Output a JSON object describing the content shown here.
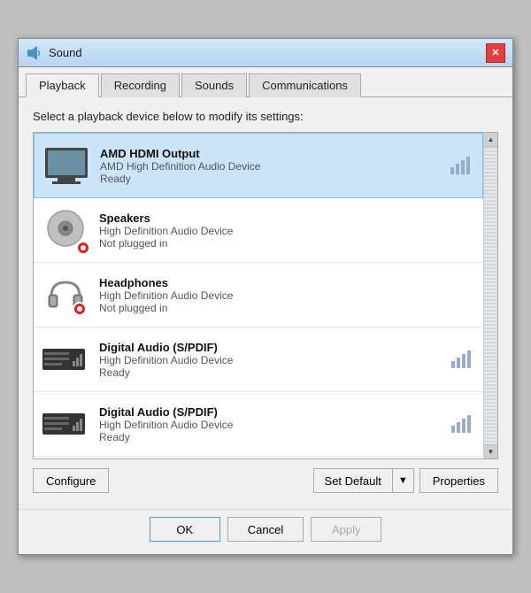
{
  "window": {
    "title": "Sound",
    "close_label": "✕"
  },
  "tabs": [
    {
      "id": "playback",
      "label": "Playback",
      "active": true
    },
    {
      "id": "recording",
      "label": "Recording",
      "active": false
    },
    {
      "id": "sounds",
      "label": "Sounds",
      "active": false
    },
    {
      "id": "communications",
      "label": "Communications",
      "active": false
    }
  ],
  "content": {
    "instruction": "Select a playback device below to modify its settings:",
    "devices": [
      {
        "id": "amd-hdmi",
        "name": "AMD HDMI Output",
        "driver": "AMD High Definition Audio Device",
        "status": "Ready",
        "selected": true,
        "icon_type": "tv"
      },
      {
        "id": "speakers",
        "name": "Speakers",
        "driver": "High Definition Audio Device",
        "status": "Not plugged in",
        "selected": false,
        "icon_type": "speaker"
      },
      {
        "id": "headphones",
        "name": "Headphones",
        "driver": "High Definition Audio Device",
        "status": "Not plugged in",
        "selected": false,
        "icon_type": "headphone"
      },
      {
        "id": "digital1",
        "name": "Digital Audio (S/PDIF)",
        "driver": "High Definition Audio Device",
        "status": "Ready",
        "selected": false,
        "icon_type": "digital"
      },
      {
        "id": "digital2",
        "name": "Digital Audio (S/PDIF)",
        "driver": "High Definition Audio Device",
        "status": "Ready",
        "selected": false,
        "icon_type": "digital"
      }
    ]
  },
  "buttons": {
    "configure": "Configure",
    "set_default": "Set Default",
    "properties": "Properties",
    "ok": "OK",
    "cancel": "Cancel",
    "apply": "Apply"
  }
}
